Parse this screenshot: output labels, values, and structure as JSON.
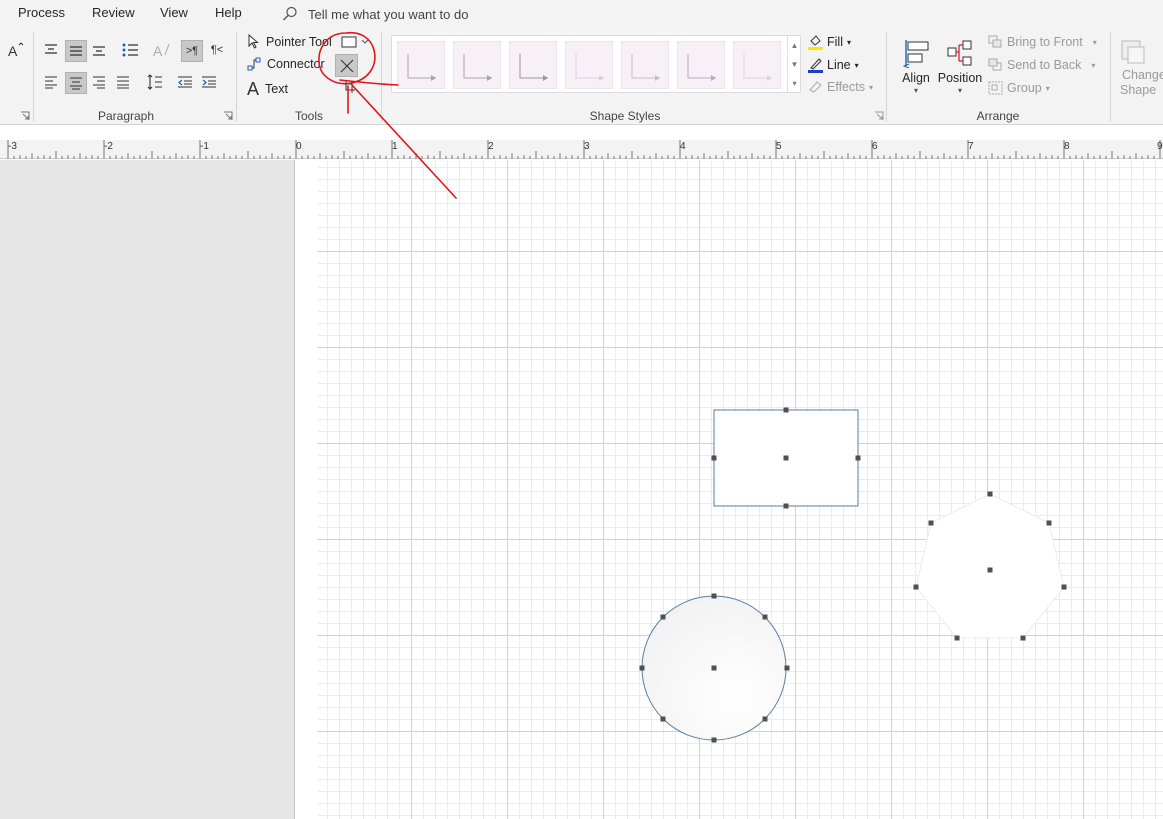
{
  "menubar": {
    "items": [
      "Process",
      "Review",
      "View",
      "Help"
    ],
    "tellme": "Tell me what you want to do"
  },
  "ribbon": {
    "groups": {
      "paragraph": "Paragraph",
      "tools": "Tools",
      "shape_styles": "Shape Styles",
      "arrange": "Arrange"
    },
    "tools": {
      "pointer": "Pointer Tool",
      "connector": "Connector",
      "text": "Text"
    },
    "format": {
      "fill": "Fill",
      "line": "Line",
      "effects": "Effects",
      "fill_color": "#ffe600",
      "line_color": "#1f3fbf"
    },
    "arrange": {
      "align": "Align",
      "position": "Position",
      "bring_to_front": "Bring to Front",
      "send_to_back": "Send to Back",
      "group": "Group",
      "change_shape_1": "Change",
      "change_shape_2": "Shape"
    }
  },
  "ruler": {
    "labels": [
      "-3",
      "-2",
      "-1",
      "0",
      "1",
      "2",
      "3",
      "4",
      "5",
      "6",
      "7",
      "8",
      "9"
    ]
  },
  "annotation": {
    "color": "#e0161c"
  },
  "colors": {
    "shape_stroke": "#5b7ba6",
    "handle": "#505050"
  }
}
